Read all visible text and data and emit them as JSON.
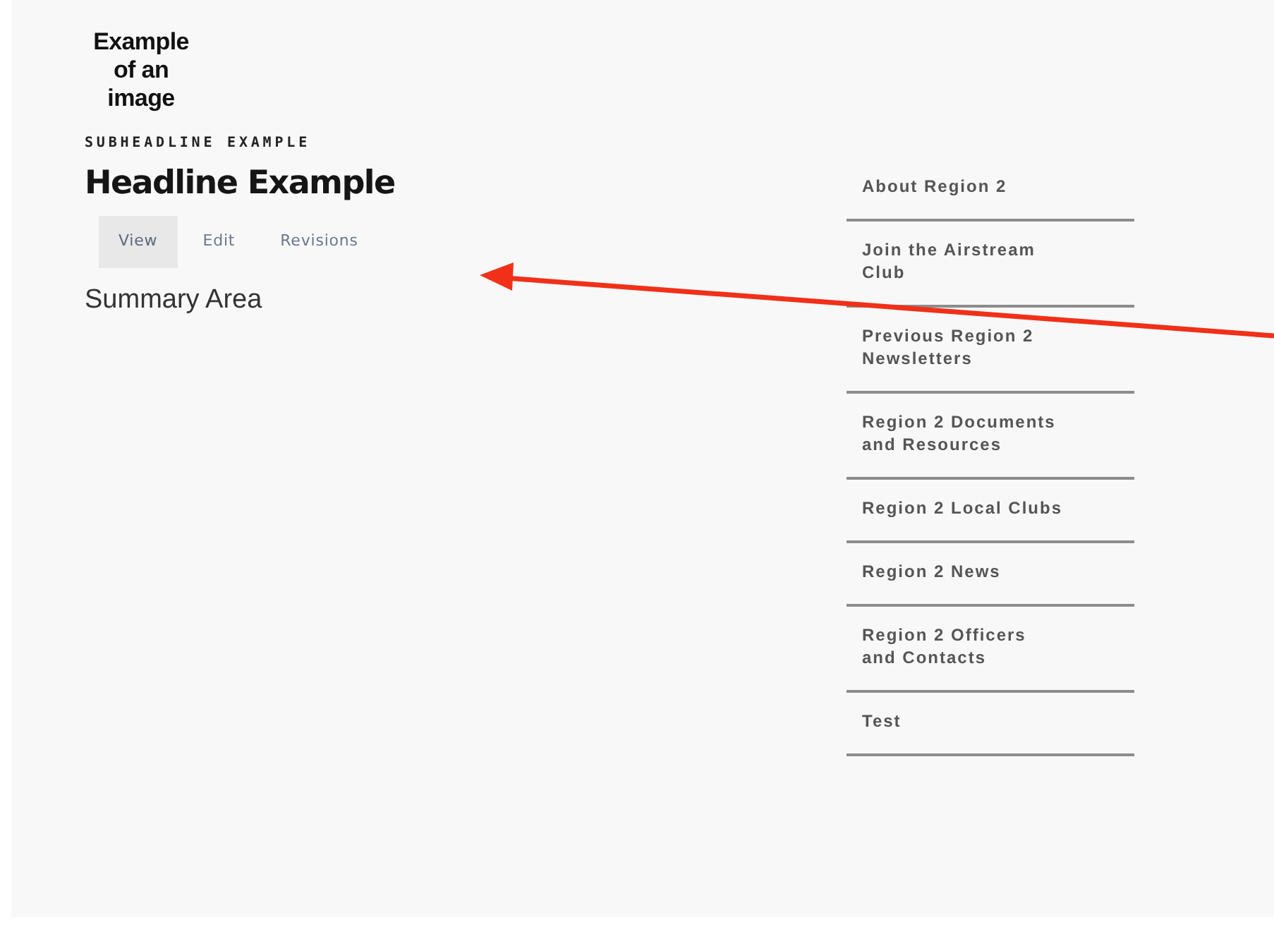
{
  "image_placeholder": {
    "text": "Example of an image"
  },
  "subheadline": "SUBHEADLINE EXAMPLE",
  "headline": "Headline Example",
  "tabs": [
    {
      "label": "View",
      "selected": true
    },
    {
      "label": "Edit",
      "selected": false
    },
    {
      "label": "Revisions",
      "selected": false
    }
  ],
  "summary": "Summary Area",
  "sidebar": {
    "items": [
      {
        "label": "About Region 2"
      },
      {
        "label": "Join the Airstream Club"
      },
      {
        "label": "Previous Region 2 Newsletters"
      },
      {
        "label": "Region 2 Documents and Resources"
      },
      {
        "label": "Region 2 Local Clubs"
      },
      {
        "label": "Region 2 News"
      },
      {
        "label": "Region 2 Officers and Contacts"
      },
      {
        "label": "Test"
      }
    ]
  },
  "annotation": {
    "kind": "arrow",
    "color": "#f03018"
  }
}
